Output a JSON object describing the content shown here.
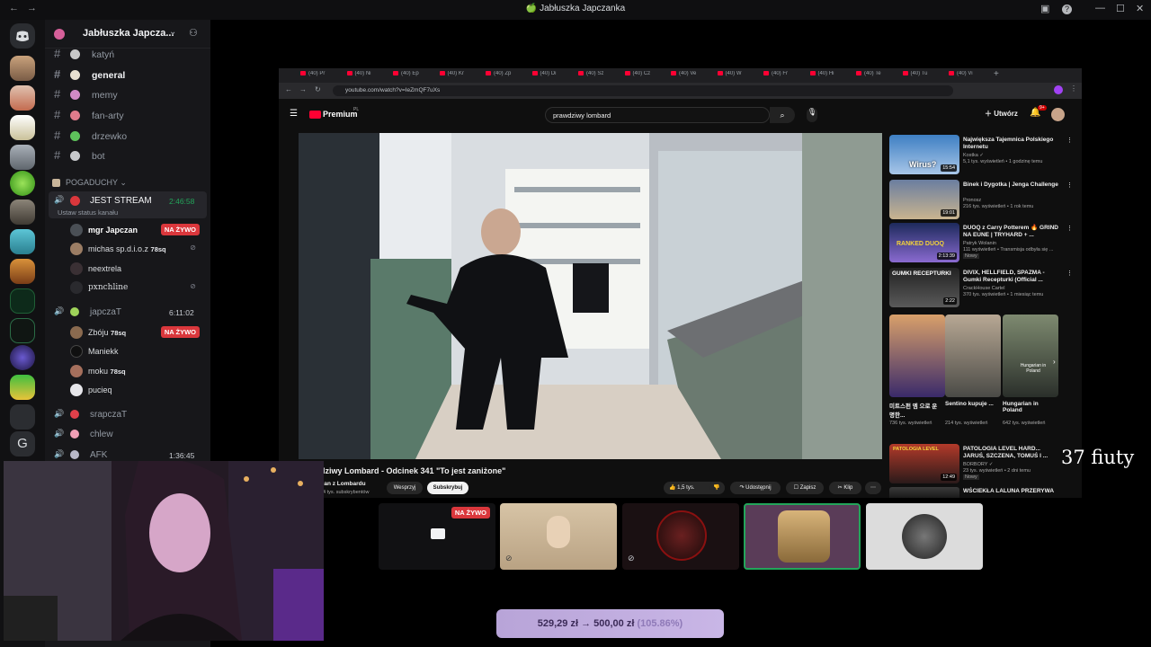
{
  "window": {
    "title": "🍏 Jabłuszka Japczanka"
  },
  "server": {
    "name": "Jabłuszka Japcza..."
  },
  "channels": [
    "katyń",
    "general",
    "memy",
    "fan-arty",
    "drzewko",
    "bot"
  ],
  "category": "POGADUCHY",
  "voice": {
    "jest_stream": {
      "name": "JEST STREAM",
      "time": "2:46:58",
      "status": "Ustaw status kanału"
    },
    "japczat": {
      "name": "japczaT",
      "time": "6:11:02"
    },
    "srapczat": {
      "name": "srapczaT"
    },
    "chlew": {
      "name": "chlew"
    },
    "afk": {
      "name": "AFK",
      "time": "1:36:45"
    }
  },
  "users_stream": [
    {
      "name": "mgr Japczan",
      "live": "NA ŻYWO"
    },
    {
      "name": "michas sp.d.i.o.z",
      "tag": "78sq"
    },
    {
      "name": "neextrela"
    },
    {
      "name": "pxnchline"
    }
  ],
  "users_japczat": [
    {
      "name": "Zbóju",
      "tag": "78sq",
      "live": "NA ŻYWO"
    },
    {
      "name": "Maniekk"
    },
    {
      "name": "moku",
      "tag": "78sq"
    },
    {
      "name": "pucieq"
    }
  ],
  "browser": {
    "url": "youtube.com/watch?v=IeZmQF7uXs",
    "tab_label": "(40)",
    "tabs": [
      "(40) Pr",
      "(40) Ni",
      "(40) Ep",
      "(40) Kr",
      "(40) Zp",
      "(40) Di",
      "(40) Sz",
      "(40) Cz",
      "(40) Ve",
      "(40) W",
      "(40) Fr",
      "(40) Hi",
      "(40) Te",
      "(40) Tu",
      "(40) Vi"
    ]
  },
  "youtube": {
    "logo": "Premium",
    "logo_sup": "PL",
    "search": "prawdziwy lombard",
    "create": "Utwórz",
    "notif": "9+",
    "video_title": "dziwy Lombard - Odcinek 341 \"To jest zaniżone\"",
    "channel": "Pan z Lombardu",
    "subs": "44 tys. subskrybentów",
    "support": "Wesprzyj",
    "subscribe": "Subskrybuj",
    "likes": "1,5 tys.",
    "share": "Udostępnij",
    "save": "Zapisz",
    "clip": "Klip",
    "recs": [
      {
        "title": "Największa Tajemnica Polskiego Internetu",
        "channel": "Kostka",
        "meta": "5,1 tys. wyświetleń • 1 godzinę temu",
        "dur": "15:54",
        "thumb_text": "Wirus?"
      },
      {
        "title": "Binek i Dygotka | Jenga Challenge",
        "channel": "Pronosz",
        "meta": "216 tys. wyświetleń • 1 rok temu",
        "dur": "19:01"
      },
      {
        "title": "DUOQ z Carry Potterem 🔥 GRIND NA EUNE | TRYHARD + ...",
        "channel": "Patryk Wolanin",
        "meta": "111 wyświetleń • Transmisja odbyła się ...",
        "dur": "2:13:39",
        "badge": "Nowy",
        "thumb_text": "RANKED DUOQ"
      },
      {
        "title": "DIVIX, HELLFIELD, SPAZMA - Gumki Recepturki (Official ...",
        "channel": "CrackHouse Cartel",
        "meta": "370 tys. wyświetleń • 1 miesiąc temu",
        "dur": "2:22",
        "thumb_text": "GUMKI RECEPTURKI"
      },
      {
        "title": "PATOLOGIA LEVEL HARD... JARUŚ, SZCZENA, TOMUŚ I ...",
        "channel": "BORBORY",
        "meta": "23 tys. wyświetleń • 2 dni temu",
        "dur": "12:49",
        "badge": "Nowy",
        "thumb_text": "PATOLOGIA LEVEL"
      },
      {
        "title": "WŚCIEKŁA LALUNA PRZERYWA"
      }
    ],
    "shorts": [
      {
        "title": "미트스펀 엠 으로 운명한...",
        "views": "736 tys. wyświetleń"
      },
      {
        "title": "Sentino kupuje ...",
        "views": "214 tys. wyświetleń"
      },
      {
        "title": "Hungarian in Poland",
        "views": "642 tys. wyświetleń",
        "overlay": "Hungarian in Poland"
      }
    ]
  },
  "tiles": {
    "live": "NA ŻYWO"
  },
  "overlay_text": "37 fiuty",
  "donation": {
    "main": "529,29 zł → 500,00 zł",
    "pct": "(105.86%)"
  },
  "colors": {
    "accent": "#5865f2",
    "live": "#da373c",
    "online": "#23a55a"
  }
}
